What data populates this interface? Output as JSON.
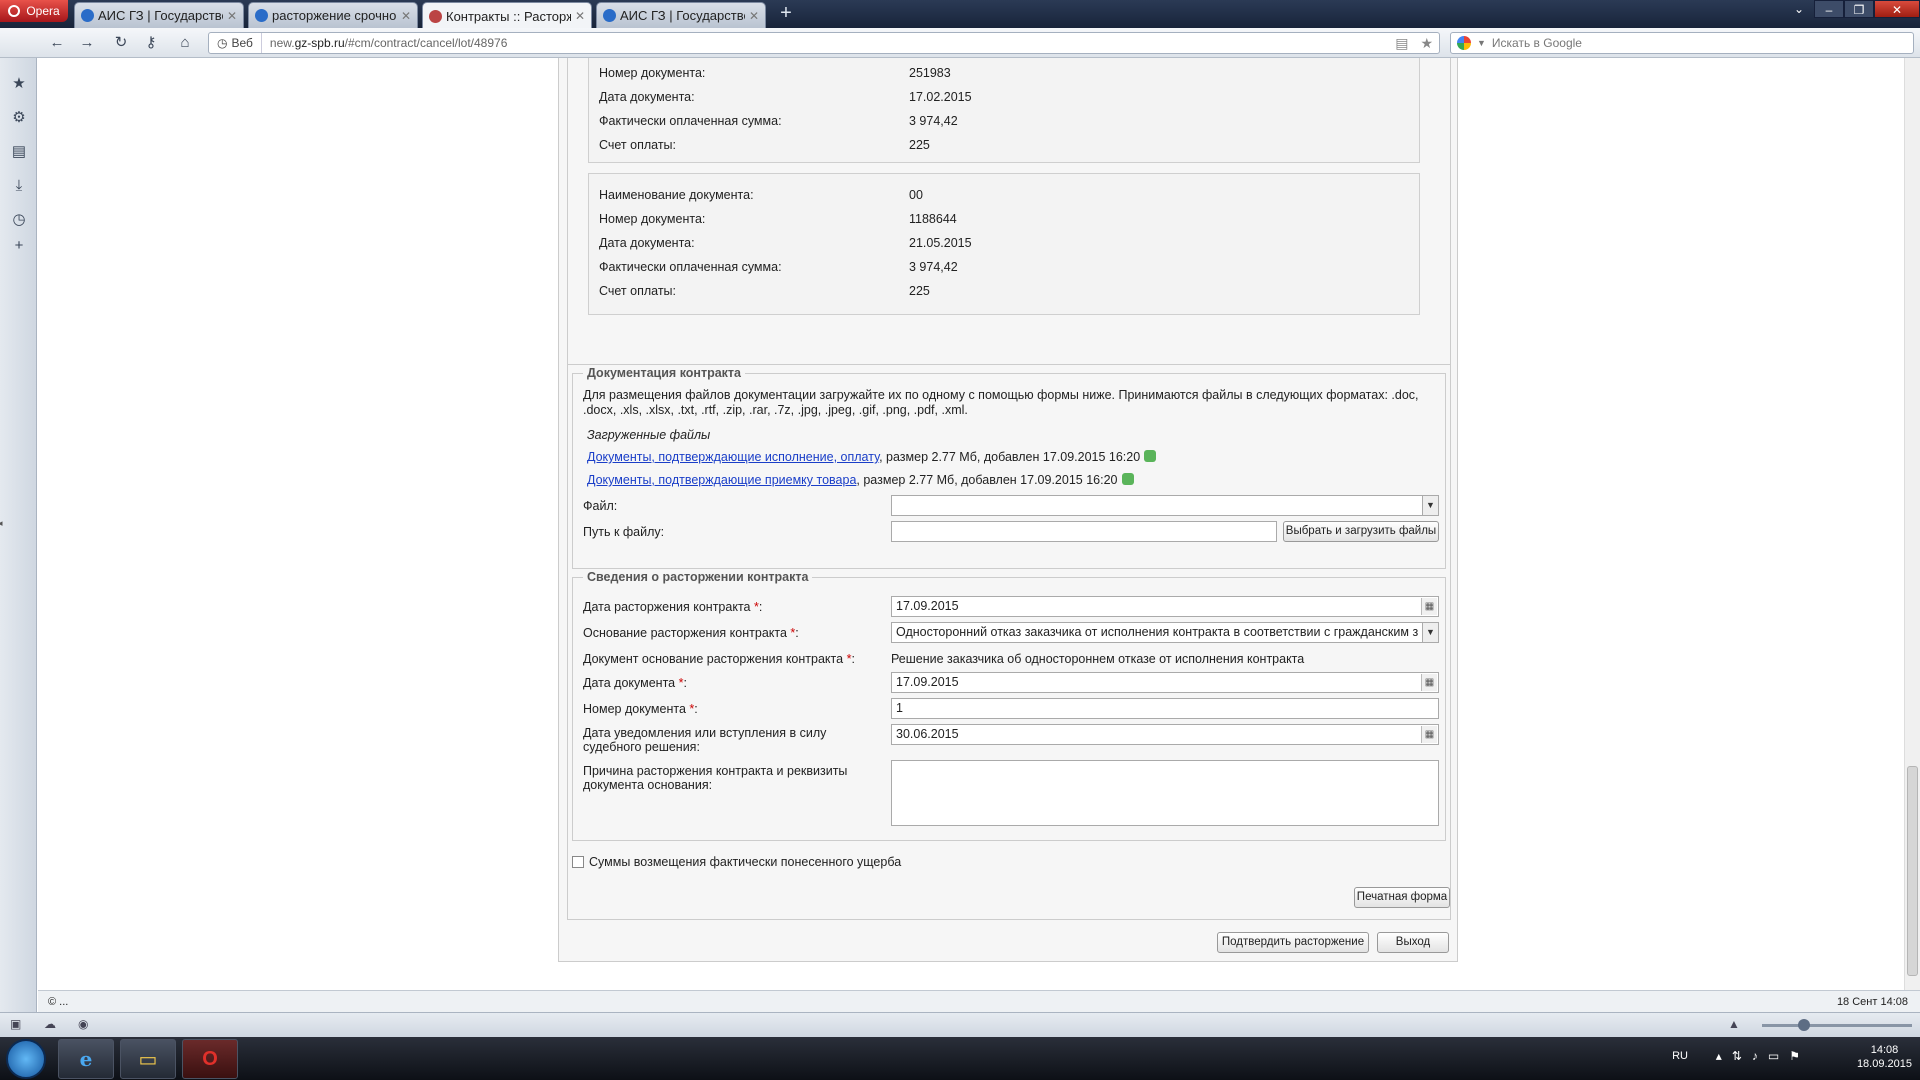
{
  "browser": {
    "menu_label": "Opera",
    "tabs": [
      {
        "title": "АИС ГЗ | Государстве...",
        "active": false
      },
      {
        "title": "расторжение срочно!!...",
        "active": false
      },
      {
        "title": "Контракты :: Расторж...",
        "active": true
      },
      {
        "title": "АИС ГЗ | Государстве...",
        "active": false
      }
    ],
    "address_mode": "Веб",
    "url_host": "new.gz-spb.ru",
    "url_prefix": "new.",
    "url_domain": "gz-spb.ru",
    "url_path": "/#cm/contract/cancel/lot/48976",
    "search_placeholder": "Искать в Google",
    "status_left": "© ...",
    "status_right": "18 Сент 14:08"
  },
  "payments": {
    "top_block": [
      {
        "label": "Номер документа:",
        "value": "251983"
      },
      {
        "label": "Дата документа:",
        "value": "17.02.2015"
      },
      {
        "label": "Фактически оплаченная сумма:",
        "value": "3 974,42"
      },
      {
        "label": "Счет оплаты:",
        "value": "225"
      }
    ],
    "second_block": [
      {
        "label": "Наименование документа:",
        "value": "00"
      },
      {
        "label": "Номер документа:",
        "value": "1188644"
      },
      {
        "label": "Дата документа:",
        "value": "21.05.2015"
      },
      {
        "label": "Фактически оплаченная сумма:",
        "value": "3 974,42"
      },
      {
        "label": "Счет оплаты:",
        "value": "225"
      }
    ]
  },
  "documentation": {
    "legend": "Документация контракта",
    "intro": "Для размещения файлов документации загружайте их по одному с помощью формы ниже. Принимаются файлы в следующих форматах: .doc, .docx, .xls, .xlsx, .txt, .rtf, .zip, .rar, .7z, .jpg, .jpeg, .gif, .png, .pdf, .xml.",
    "uploaded_title": "Загруженные файлы",
    "files": [
      {
        "name": "Документы, подтверждающие исполнение, оплату",
        "meta": ", размер 2.77 Мб, добавлен 17.09.2015 16:20"
      },
      {
        "name": "Документы, подтверждающие приемку товара",
        "meta": ", размер 2.77 Мб, добавлен 17.09.2015 16:20"
      }
    ],
    "file_label": "Файл:",
    "path_label": "Путь к файлу:",
    "upload_button": "Выбрать и загрузить файлы"
  },
  "termination": {
    "legend": "Сведения о расторжении контракта",
    "date_label": "Дата расторжения контракта",
    "date_value": "17.09.2015",
    "basis_label": "Основание расторжения контракта",
    "basis_value": "Односторонний отказ заказчика от исполнения контракта в соответствии с гражданским з",
    "basis_doc_label": "Документ основание расторжения контракта",
    "basis_doc_value": "Решение заказчика об одностороннем отказе от исполнения контракта",
    "doc_date_label": "Дата документа",
    "doc_date_value": "17.09.2015",
    "doc_number_label": "Номер документа",
    "doc_number_value": "1",
    "notify_label_1": "Дата уведомления или вступления в силу",
    "notify_label_2": "судебного решения:",
    "notify_value": "30.06.2015",
    "reason_label_1": "Причина расторжения контракта и реквизиты",
    "reason_label_2": "документа основания:",
    "reason_value": "",
    "required_mark": "*",
    "colon": ":"
  },
  "damage_checkbox_label": "Суммы возмещения фактически понесенного ущерба",
  "buttons": {
    "print": "Печатная форма",
    "confirm": "Подтвердить расторжение",
    "exit": "Выход"
  },
  "taskbar": {
    "lang": "RU",
    "time": "14:08",
    "date": "18.09.2015"
  }
}
